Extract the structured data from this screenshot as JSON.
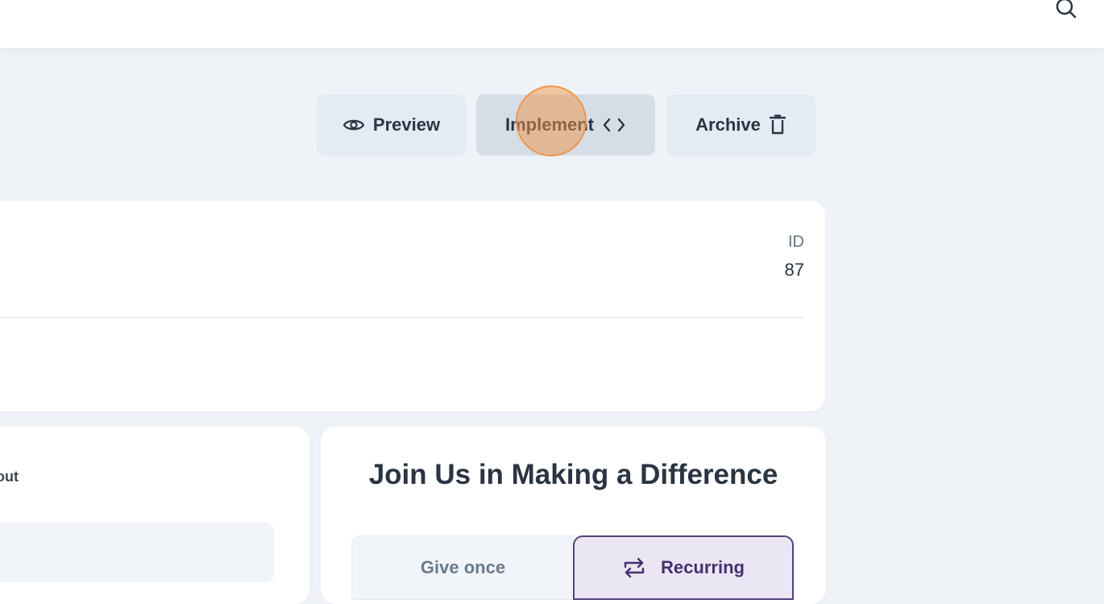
{
  "topbar": {
    "search_icon": "search-icon"
  },
  "actions": {
    "preview_label": "Preview",
    "implement_label": "Implement",
    "archive_label": "Archive"
  },
  "details": {
    "id_label": "ID",
    "id_value": "87"
  },
  "left_card": {
    "label_fragment": "out"
  },
  "donation": {
    "title": "Join Us in Making a Difference",
    "give_once_label": "Give once",
    "recurring_label": "Recurring"
  },
  "colors": {
    "background": "#eff3f7",
    "accent": "#57407d",
    "cursor_highlight": "#f0964a"
  }
}
